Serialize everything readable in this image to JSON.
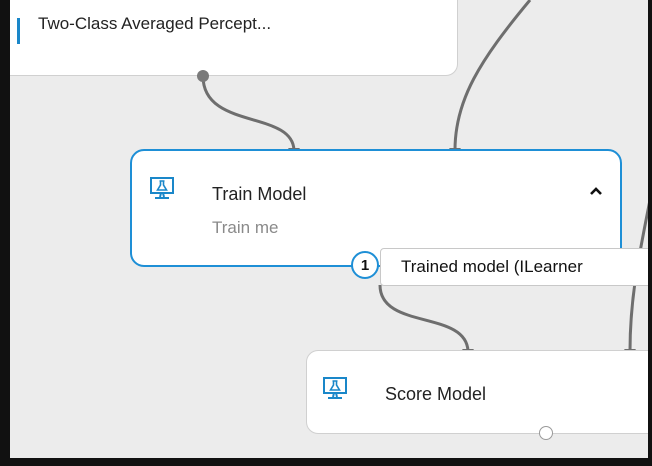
{
  "modules": {
    "perceptron": {
      "label": "Two-Class Averaged Percept..."
    },
    "train_model": {
      "title": "Train Model",
      "subtitle": "Train me",
      "collapse_glyph": "^"
    },
    "score_model": {
      "title": "Score Model"
    }
  },
  "output_port": {
    "index": "1",
    "tooltip": "Trained model (ILearner"
  },
  "colors": {
    "selected_border": "#1e8fd6",
    "accent": "#1a87c9",
    "wire": "#6e6e6e",
    "canvas": "#ececec"
  },
  "icons": {
    "module_icon": "monitor-flask-icon",
    "collapse": "chevron-up-icon",
    "port": "output-port-icon"
  }
}
